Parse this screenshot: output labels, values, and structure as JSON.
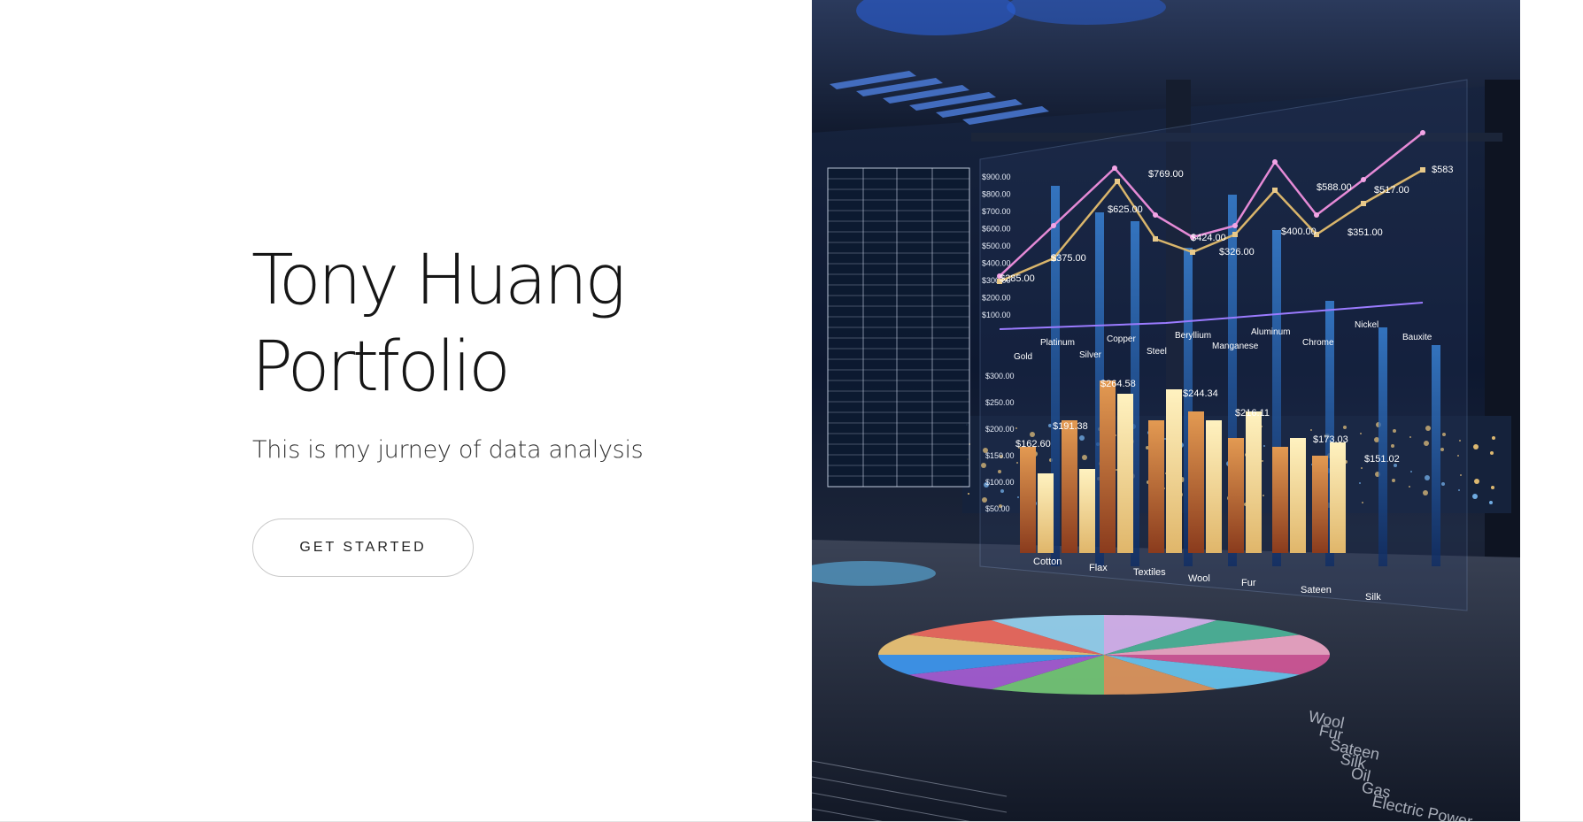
{
  "hero": {
    "title_line1": "Tony Huang",
    "title_line2": "Portfolio",
    "subtitle": "This is my jurney of data analysis",
    "cta_label": "GET STARTED"
  },
  "image": {
    "kind": "data-visualization-office-photo",
    "line_labels": [
      "$285.00",
      "$375.00",
      "$625.00",
      "$769.00",
      "$424.00",
      "$326.00",
      "$400.00",
      "$588.00",
      "$351.00",
      "$517.00",
      "$583"
    ],
    "bar_labels": [
      "$162.60",
      "$191.38",
      "$264.58",
      "$244.34",
      "$216.11",
      "$173.03",
      "$151.02"
    ],
    "top_axis": [
      "$900.00",
      "$800.00",
      "$700.00",
      "$600.00",
      "$500.00",
      "$400.00",
      "$300.00",
      "$200.00",
      "$100.00"
    ],
    "bottom_axis": [
      "$300.00",
      "$250.00",
      "$200.00",
      "$150.00",
      "$100.00",
      "$50.00"
    ],
    "materials_top": [
      "Gold",
      "Platinum",
      "Silver",
      "Copper",
      "Steel",
      "Beryllium",
      "Manganese",
      "Aluminum",
      "Chrome",
      "Nickel",
      "Bauxite"
    ],
    "materials_bottom": [
      "Cotton",
      "Flax",
      "Textiles",
      "Wool",
      "Fur",
      "Sateen",
      "Silk"
    ],
    "floor_labels": [
      "Wool",
      "Fur",
      "Sateen",
      "Silk",
      "Oil",
      "Gas",
      "Electric Power"
    ]
  }
}
